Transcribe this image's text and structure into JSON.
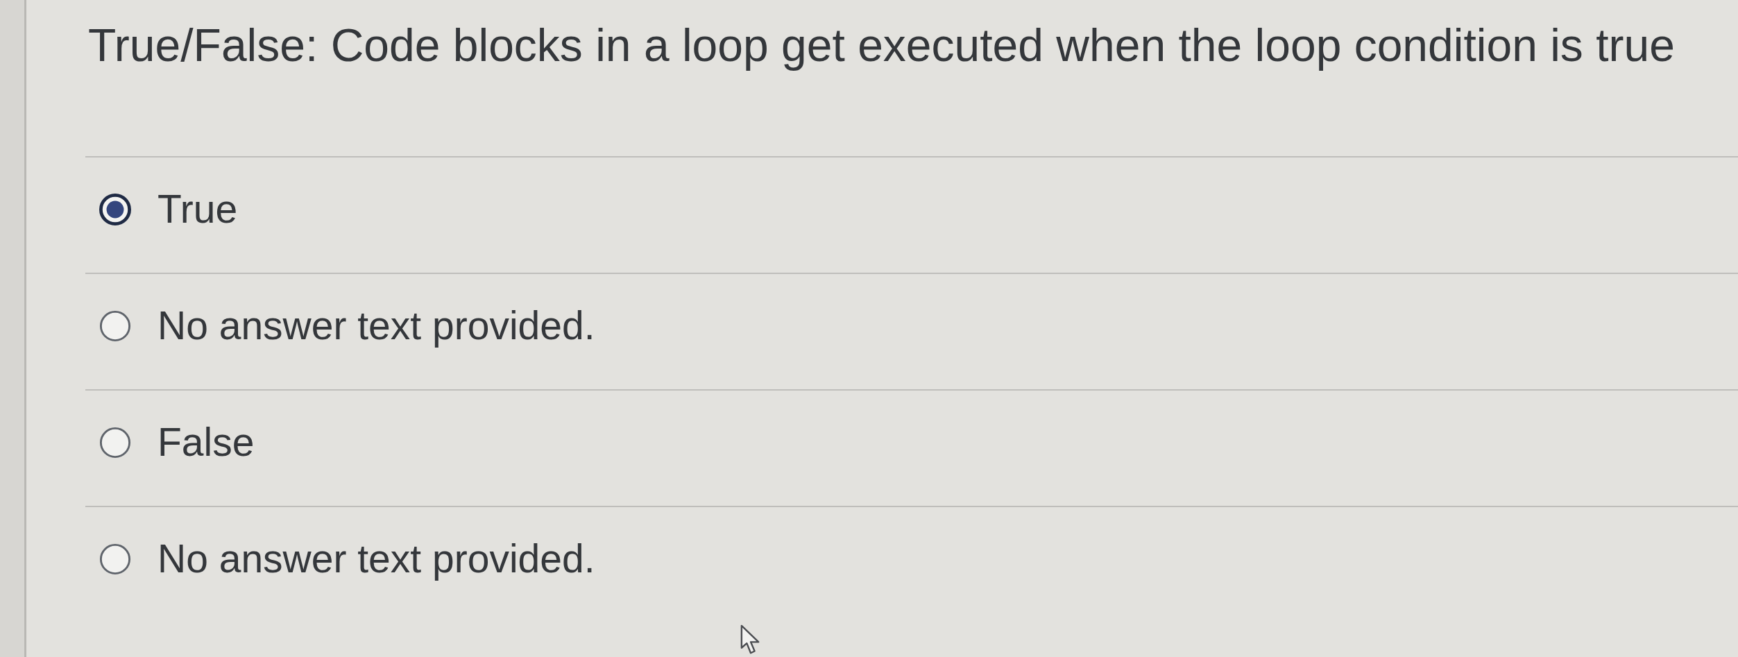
{
  "question": {
    "text": "True/False: Code blocks in a loop get executed when the loop condition is true"
  },
  "answers": [
    {
      "label": "True",
      "selected": true
    },
    {
      "label": "No answer text provided.",
      "selected": false
    },
    {
      "label": "False",
      "selected": false
    },
    {
      "label": "No answer text provided.",
      "selected": false
    }
  ]
}
